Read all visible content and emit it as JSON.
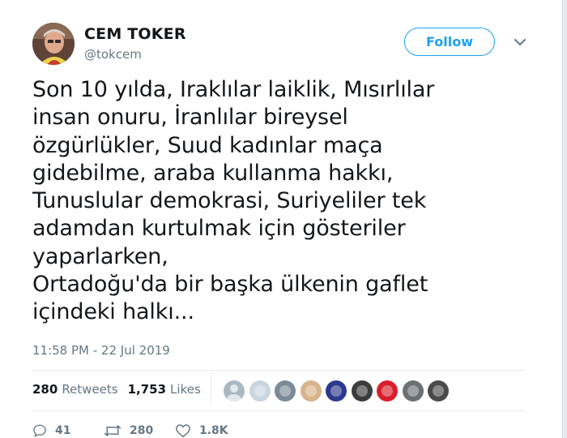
{
  "author": {
    "display_name": "CEM TOKER",
    "handle": "@tokcem"
  },
  "follow_label": "Follow",
  "tweet": {
    "text": "Son 10 yılda, Iraklılar laiklik, Mısırlılar\ninsan onuru, İranlılar bireysel\nözgürlükler, Suud kadınlar maça\ngidebilme, araba kullanma hakkı,\nTunuslular demokrasi, Suriyeliler tek\nadamdan kurtulmak için gösteriler\nyaparlarken,\nOrtadoğu'da bir başka ülkenin gaflet\niçindeki halkı...",
    "timestamp": "11:58 PM - 22 Jul 2019"
  },
  "stats": {
    "retweets_count": "280",
    "retweets_label": "Retweets",
    "likes_count": "1,753",
    "likes_label": "Likes"
  },
  "likers": [
    {
      "name": "liker-avatar-default",
      "color": "#aab8c2"
    },
    {
      "name": "liker-avatar-2",
      "color": "#c9d6df"
    },
    {
      "name": "liker-avatar-3",
      "color": "#7a8a96"
    },
    {
      "name": "liker-avatar-4",
      "color": "#d9b38c"
    },
    {
      "name": "liker-avatar-5",
      "color": "#2b3a8c"
    },
    {
      "name": "liker-avatar-6",
      "color": "#3c3c3c"
    },
    {
      "name": "liker-avatar-7",
      "color": "#d81e2a"
    },
    {
      "name": "liker-avatar-8",
      "color": "#6b7074"
    },
    {
      "name": "liker-avatar-9",
      "color": "#4a4a4a"
    }
  ],
  "actions": {
    "replies": "41",
    "retweets": "280",
    "likes": "1.8K"
  },
  "colors": {
    "accent": "#1da1f2",
    "text": "#14171a",
    "secondary": "#657786",
    "border": "#e6ecf0"
  }
}
